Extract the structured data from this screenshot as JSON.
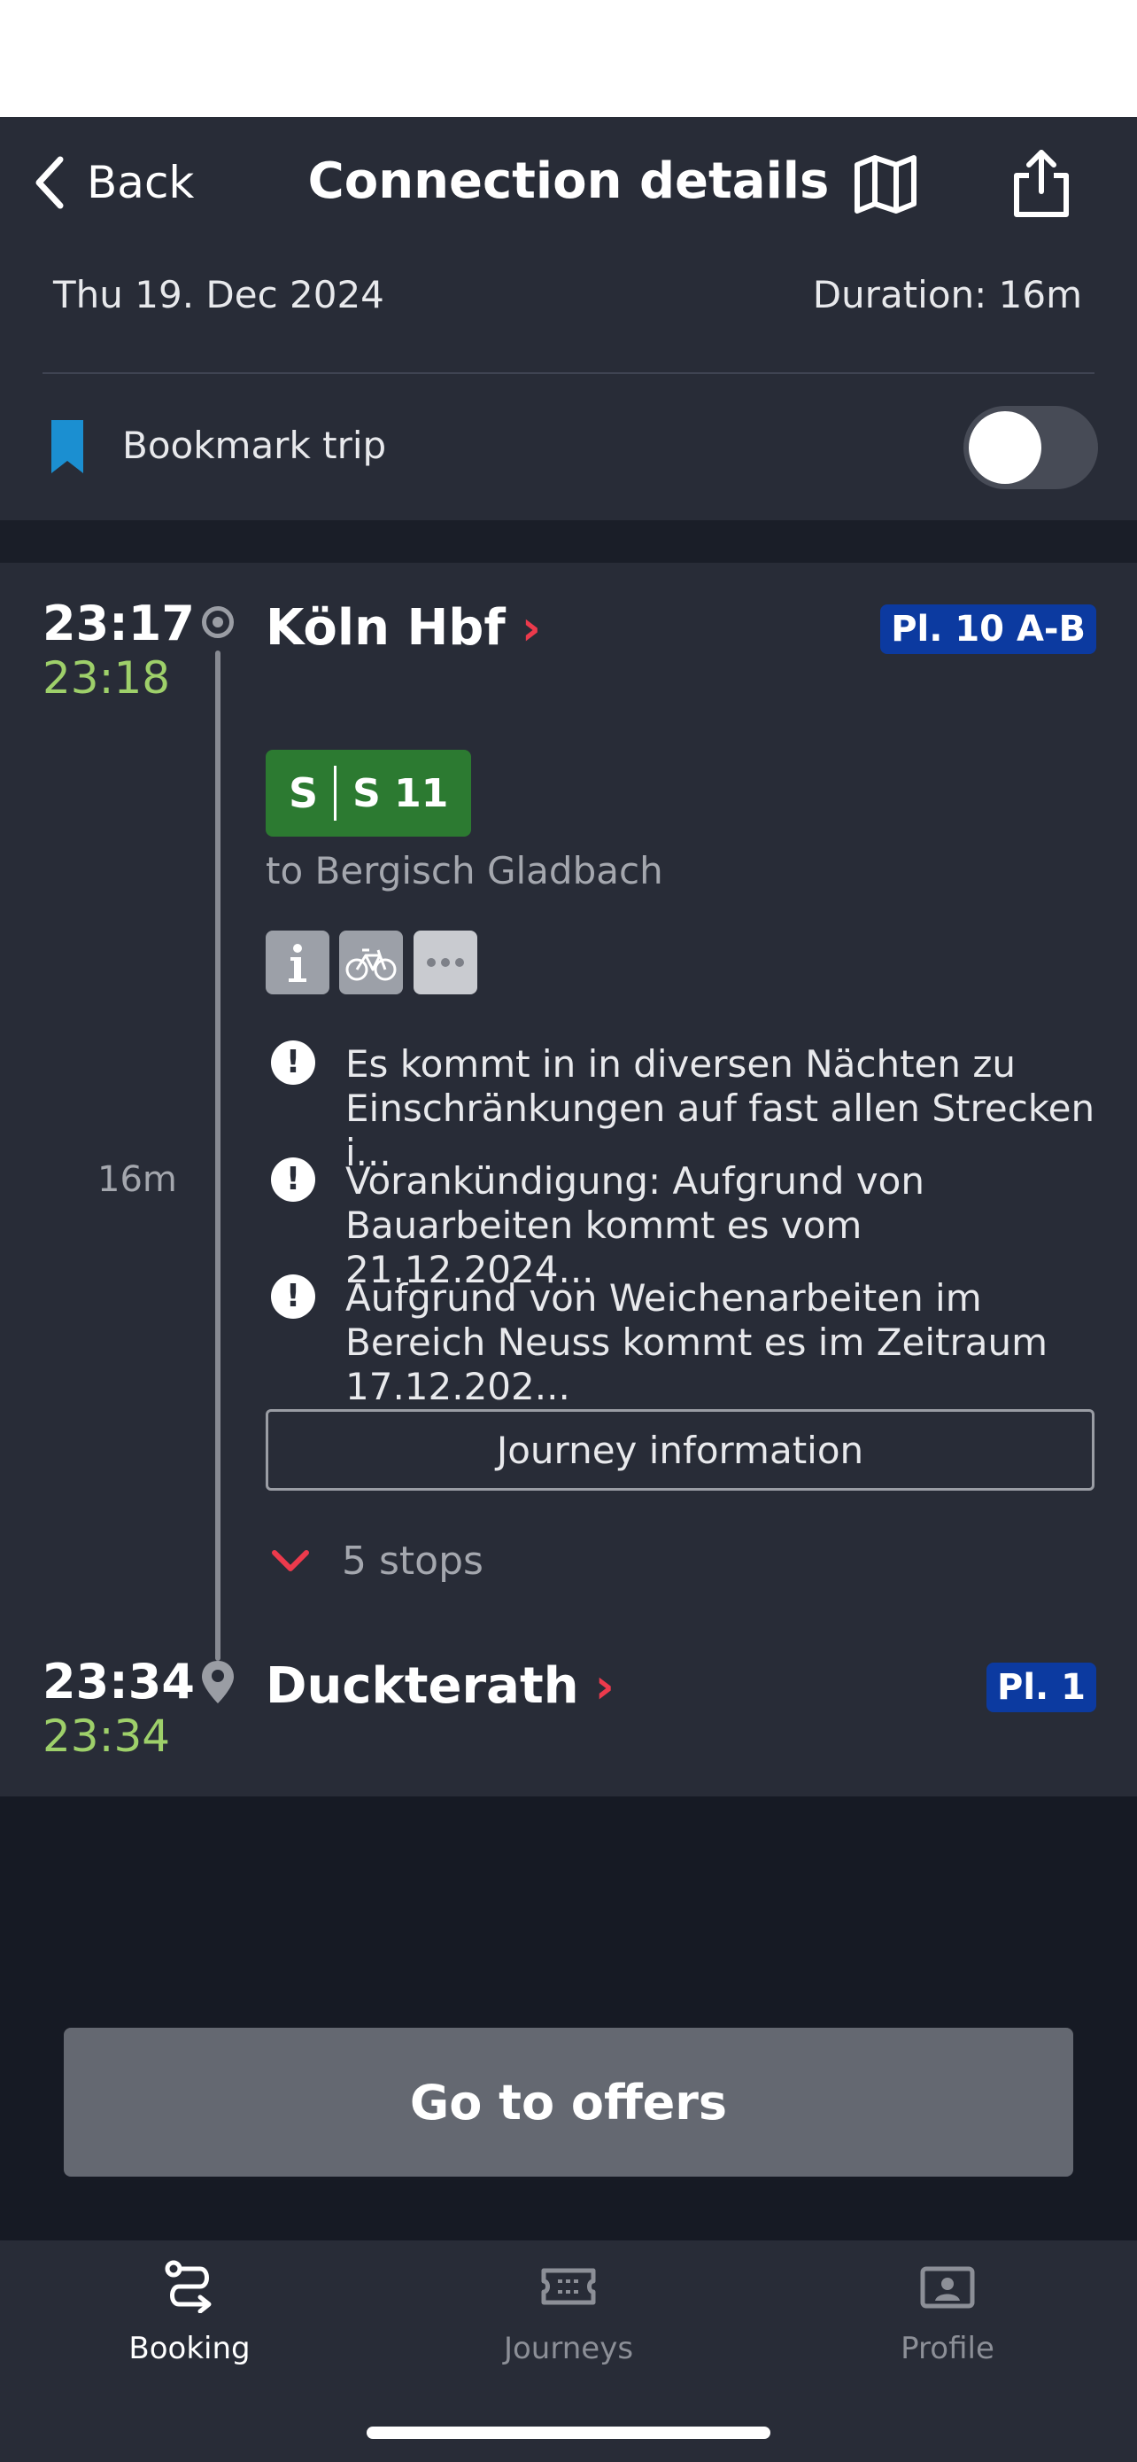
{
  "header": {
    "back_label": "Back",
    "title": "Connection details",
    "map_icon": "map-icon",
    "share_icon": "share-icon"
  },
  "trip": {
    "date": "Thu 19. Dec 2024",
    "duration": "Duration: 16m",
    "bookmark_label": "Bookmark trip",
    "bookmark_enabled": false
  },
  "departure": {
    "scheduled": "23:17",
    "realtime": "23:18",
    "station": "Köln Hbf",
    "platform": "Pl. 10 A-B"
  },
  "line": {
    "product": "S",
    "name": "S 11",
    "direction": "to Bergisch Gladbach",
    "color": "#2c7a31",
    "attributes": [
      "info-icon",
      "bicycle-icon",
      "more-icon"
    ]
  },
  "segment_duration": "16m",
  "messages": [
    "Es kommt in  in diversen Nächten zu Einschränkungen auf fast allen Strecken i...",
    "Vorankündigung: Aufgrund von Bauarbeiten kommt es vom 21.12.2024...",
    "Aufgrund von Weichenarbeiten im Bereich Neuss kommt es im Zeitraum 17.12.202..."
  ],
  "journey_info_label": "Journey information",
  "stops_label": "5 stops",
  "arrival": {
    "scheduled": "23:34",
    "realtime": "23:34",
    "station": "Duckterath",
    "platform": "Pl. 1"
  },
  "offers_button": "Go to offers",
  "tabs": [
    {
      "label": "Booking",
      "icon": "route-icon",
      "active": true
    },
    {
      "label": "Journeys",
      "icon": "ticket-icon",
      "active": false
    },
    {
      "label": "Profile",
      "icon": "profile-icon",
      "active": false
    }
  ],
  "colors": {
    "background": "#151a24",
    "card": "#282c37",
    "realtime_green": "#9ed06a",
    "accent_red": "#ec3a4c",
    "platform_blue": "#0c3aa0",
    "bookmark_blue": "#1b8fd1"
  }
}
